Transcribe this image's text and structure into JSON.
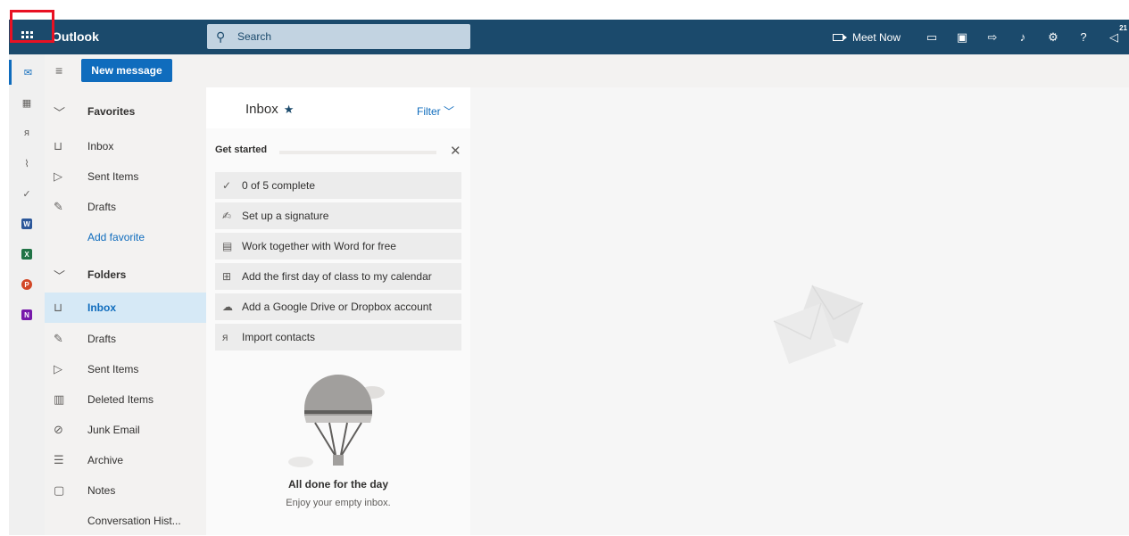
{
  "topbar": {
    "app_name": "Outlook",
    "search_placeholder": "Search",
    "meet_now": "Meet Now",
    "notification_count": "21",
    "help": "?"
  },
  "commandbar": {
    "new_message": "New message"
  },
  "folders": {
    "favorites_header": "Favorites",
    "favorites": [
      {
        "label": "Inbox",
        "icon": "inbox-icon"
      },
      {
        "label": "Sent Items",
        "icon": "send-icon"
      },
      {
        "label": "Drafts",
        "icon": "pencil-icon"
      }
    ],
    "add_favorite": "Add favorite",
    "folders_header": "Folders",
    "items": [
      {
        "label": "Inbox",
        "icon": "inbox-icon"
      },
      {
        "label": "Drafts",
        "icon": "pencil-icon"
      },
      {
        "label": "Sent Items",
        "icon": "send-icon"
      },
      {
        "label": "Deleted Items",
        "icon": "trash-icon"
      },
      {
        "label": "Junk Email",
        "icon": "block-icon"
      },
      {
        "label": "Archive",
        "icon": "archive-icon"
      },
      {
        "label": "Notes",
        "icon": "note-icon"
      },
      {
        "label": "Conversation Hist..."
      }
    ]
  },
  "messagelist": {
    "title": "Inbox",
    "filter": "Filter",
    "get_started": "Get started",
    "tasks": [
      {
        "label": "0 of 5 complete",
        "icon": "check-icon"
      },
      {
        "label": "Set up a signature",
        "icon": "signature-icon"
      },
      {
        "label": "Work together with Word for free",
        "icon": "document-icon"
      },
      {
        "label": "Add the first day of class to my calendar",
        "icon": "calendar-add-icon"
      },
      {
        "label": "Add a Google Drive or Dropbox account",
        "icon": "cloud-icon"
      },
      {
        "label": "Import contacts",
        "icon": "people-icon"
      }
    ],
    "empty_title": "All done for the day",
    "empty_subtitle": "Enjoy your empty inbox."
  },
  "colors": {
    "topbar": "#1b4a6c",
    "accent": "#0f6cbd",
    "selection": "#d6e9f6"
  }
}
